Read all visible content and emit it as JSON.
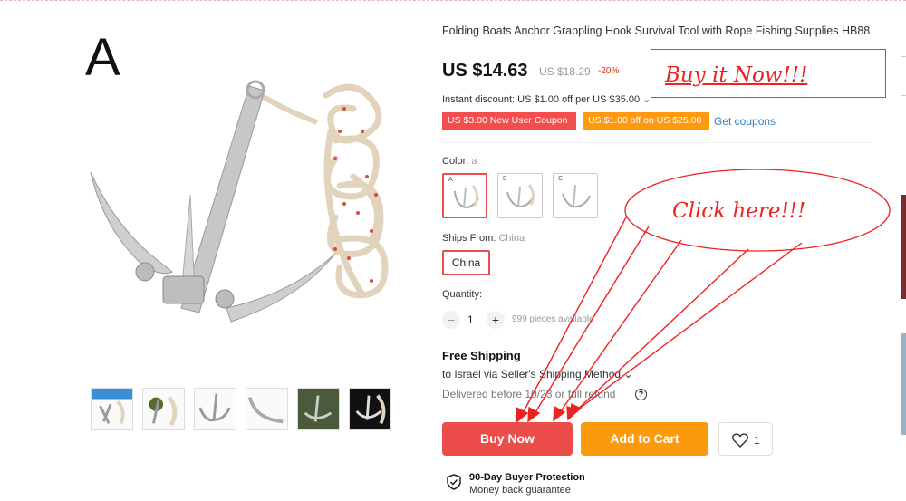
{
  "product": {
    "title": "Folding Boats Anchor Grappling Hook Survival Tool with Rope Fishing Supplies HB88",
    "variant_letter": "A",
    "price": "US $14.63",
    "old_price": "US $18.29",
    "discount": "-20%",
    "instant_discount": "Instant discount: US $1.00 off per US $35.00 ⌄",
    "coupons": [
      "US $3.00 New User Coupon",
      "US $1.00 off on US $25.00"
    ],
    "get_coupons": "Get coupons"
  },
  "color": {
    "label": "Color:",
    "selected": "a",
    "options": [
      "A",
      "B",
      "C"
    ]
  },
  "ships_from": {
    "label": "Ships From:",
    "selected": "China",
    "option": "China"
  },
  "quantity": {
    "label": "Quantity:",
    "minus": "−",
    "plus": "+",
    "value": "1",
    "available": "999 pieces available"
  },
  "shipping": {
    "title": "Free Shipping",
    "to": "to Israel via Seller's Shipping Method ⌄",
    "delivered": "Delivered before 10/23 or full refund",
    "help": "?"
  },
  "actions": {
    "buy_now": "Buy Now",
    "add_to_cart": "Add to Cart",
    "wishlist_count": "1"
  },
  "protection": {
    "title": "90-Day Buyer Protection",
    "subtitle": "Money back guarantee"
  },
  "annotations": {
    "box_text": "Buy it Now!!!",
    "ellipse_text": "Click here!!!",
    "color": "#e22222"
  },
  "colors": {
    "buy": "#ea4d4a",
    "cart": "#fb9a0c",
    "coupon_red": "#f44d4d",
    "coupon_orange": "#ff9a10",
    "link": "#2f7ec6"
  },
  "icons": [
    "heart-icon",
    "shield-check-icon",
    "help-icon",
    "chevron-down-icon"
  ]
}
